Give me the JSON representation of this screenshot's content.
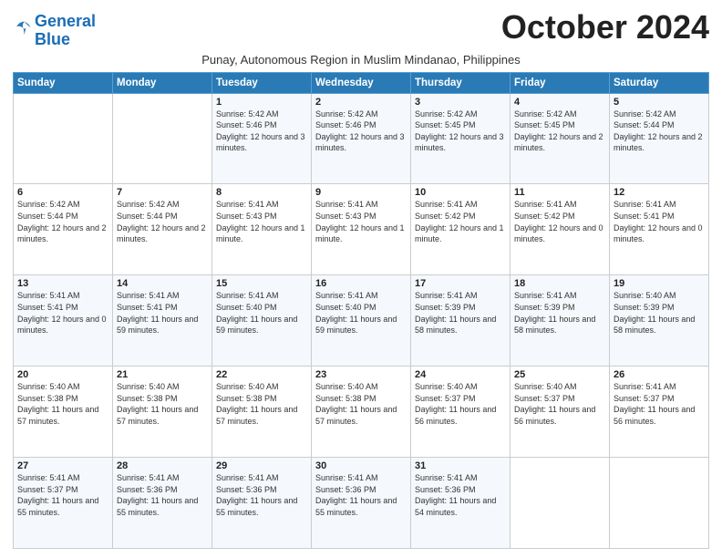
{
  "logo": {
    "line1": "General",
    "line2": "Blue"
  },
  "title": "October 2024",
  "subtitle": "Punay, Autonomous Region in Muslim Mindanao, Philippines",
  "days_header": [
    "Sunday",
    "Monday",
    "Tuesday",
    "Wednesday",
    "Thursday",
    "Friday",
    "Saturday"
  ],
  "weeks": [
    [
      {
        "day": "",
        "info": ""
      },
      {
        "day": "",
        "info": ""
      },
      {
        "day": "1",
        "info": "Sunrise: 5:42 AM\nSunset: 5:46 PM\nDaylight: 12 hours and 3 minutes."
      },
      {
        "day": "2",
        "info": "Sunrise: 5:42 AM\nSunset: 5:46 PM\nDaylight: 12 hours and 3 minutes."
      },
      {
        "day": "3",
        "info": "Sunrise: 5:42 AM\nSunset: 5:45 PM\nDaylight: 12 hours and 3 minutes."
      },
      {
        "day": "4",
        "info": "Sunrise: 5:42 AM\nSunset: 5:45 PM\nDaylight: 12 hours and 2 minutes."
      },
      {
        "day": "5",
        "info": "Sunrise: 5:42 AM\nSunset: 5:44 PM\nDaylight: 12 hours and 2 minutes."
      }
    ],
    [
      {
        "day": "6",
        "info": "Sunrise: 5:42 AM\nSunset: 5:44 PM\nDaylight: 12 hours and 2 minutes."
      },
      {
        "day": "7",
        "info": "Sunrise: 5:42 AM\nSunset: 5:44 PM\nDaylight: 12 hours and 2 minutes."
      },
      {
        "day": "8",
        "info": "Sunrise: 5:41 AM\nSunset: 5:43 PM\nDaylight: 12 hours and 1 minute."
      },
      {
        "day": "9",
        "info": "Sunrise: 5:41 AM\nSunset: 5:43 PM\nDaylight: 12 hours and 1 minute."
      },
      {
        "day": "10",
        "info": "Sunrise: 5:41 AM\nSunset: 5:42 PM\nDaylight: 12 hours and 1 minute."
      },
      {
        "day": "11",
        "info": "Sunrise: 5:41 AM\nSunset: 5:42 PM\nDaylight: 12 hours and 0 minutes."
      },
      {
        "day": "12",
        "info": "Sunrise: 5:41 AM\nSunset: 5:41 PM\nDaylight: 12 hours and 0 minutes."
      }
    ],
    [
      {
        "day": "13",
        "info": "Sunrise: 5:41 AM\nSunset: 5:41 PM\nDaylight: 12 hours and 0 minutes."
      },
      {
        "day": "14",
        "info": "Sunrise: 5:41 AM\nSunset: 5:41 PM\nDaylight: 11 hours and 59 minutes."
      },
      {
        "day": "15",
        "info": "Sunrise: 5:41 AM\nSunset: 5:40 PM\nDaylight: 11 hours and 59 minutes."
      },
      {
        "day": "16",
        "info": "Sunrise: 5:41 AM\nSunset: 5:40 PM\nDaylight: 11 hours and 59 minutes."
      },
      {
        "day": "17",
        "info": "Sunrise: 5:41 AM\nSunset: 5:39 PM\nDaylight: 11 hours and 58 minutes."
      },
      {
        "day": "18",
        "info": "Sunrise: 5:41 AM\nSunset: 5:39 PM\nDaylight: 11 hours and 58 minutes."
      },
      {
        "day": "19",
        "info": "Sunrise: 5:40 AM\nSunset: 5:39 PM\nDaylight: 11 hours and 58 minutes."
      }
    ],
    [
      {
        "day": "20",
        "info": "Sunrise: 5:40 AM\nSunset: 5:38 PM\nDaylight: 11 hours and 57 minutes."
      },
      {
        "day": "21",
        "info": "Sunrise: 5:40 AM\nSunset: 5:38 PM\nDaylight: 11 hours and 57 minutes."
      },
      {
        "day": "22",
        "info": "Sunrise: 5:40 AM\nSunset: 5:38 PM\nDaylight: 11 hours and 57 minutes."
      },
      {
        "day": "23",
        "info": "Sunrise: 5:40 AM\nSunset: 5:38 PM\nDaylight: 11 hours and 57 minutes."
      },
      {
        "day": "24",
        "info": "Sunrise: 5:40 AM\nSunset: 5:37 PM\nDaylight: 11 hours and 56 minutes."
      },
      {
        "day": "25",
        "info": "Sunrise: 5:40 AM\nSunset: 5:37 PM\nDaylight: 11 hours and 56 minutes."
      },
      {
        "day": "26",
        "info": "Sunrise: 5:41 AM\nSunset: 5:37 PM\nDaylight: 11 hours and 56 minutes."
      }
    ],
    [
      {
        "day": "27",
        "info": "Sunrise: 5:41 AM\nSunset: 5:37 PM\nDaylight: 11 hours and 55 minutes."
      },
      {
        "day": "28",
        "info": "Sunrise: 5:41 AM\nSunset: 5:36 PM\nDaylight: 11 hours and 55 minutes."
      },
      {
        "day": "29",
        "info": "Sunrise: 5:41 AM\nSunset: 5:36 PM\nDaylight: 11 hours and 55 minutes."
      },
      {
        "day": "30",
        "info": "Sunrise: 5:41 AM\nSunset: 5:36 PM\nDaylight: 11 hours and 55 minutes."
      },
      {
        "day": "31",
        "info": "Sunrise: 5:41 AM\nSunset: 5:36 PM\nDaylight: 11 hours and 54 minutes."
      },
      {
        "day": "",
        "info": ""
      },
      {
        "day": "",
        "info": ""
      }
    ]
  ]
}
